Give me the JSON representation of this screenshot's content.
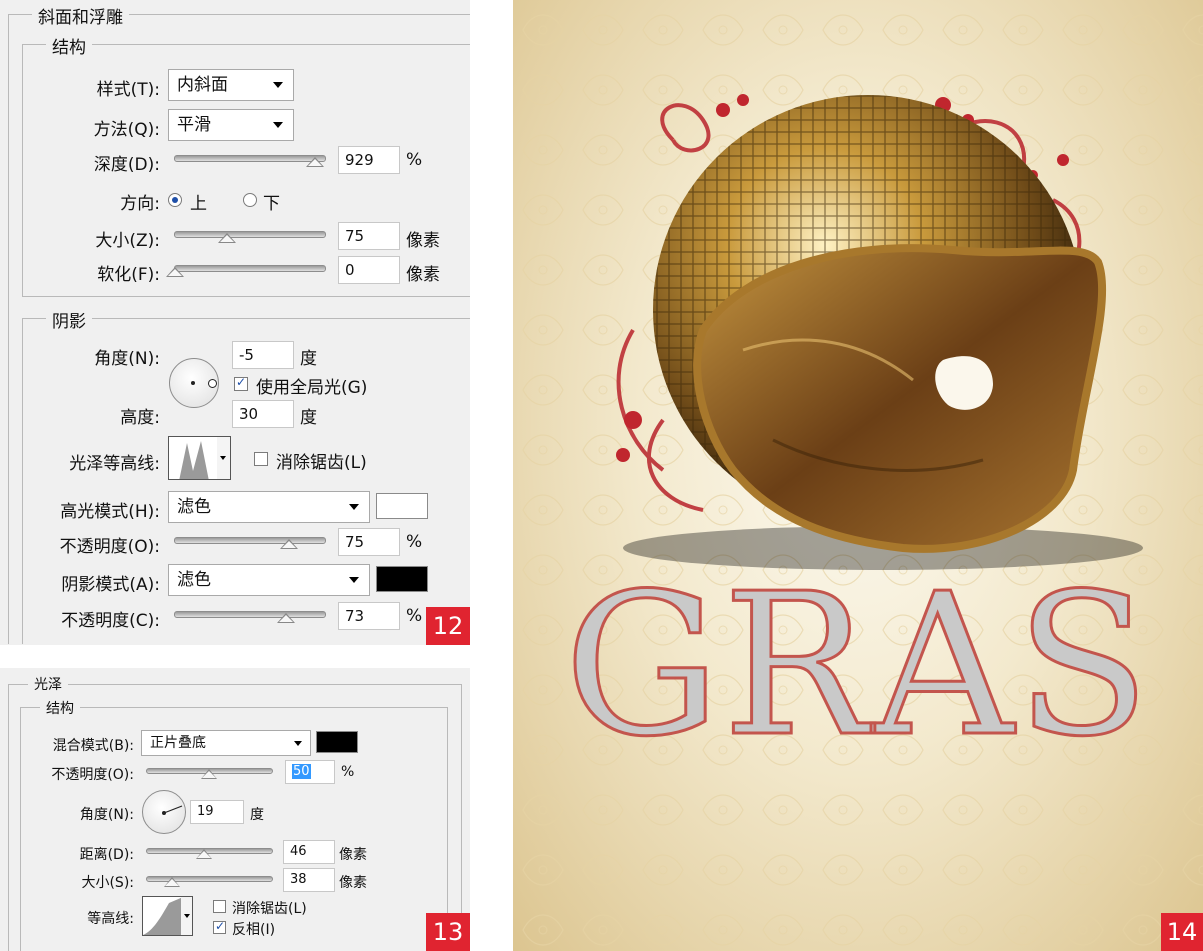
{
  "panel12": {
    "bevel_title": "斜面和浮雕",
    "structure_title": "结构",
    "style_label": "样式(T):",
    "style_value": "内斜面",
    "technique_label": "方法(Q):",
    "technique_value": "平滑",
    "depth_label": "深度(D):",
    "depth_value": "929",
    "depth_unit": "%",
    "direction_label": "方向:",
    "direction_up": "上",
    "direction_down": "下",
    "size_label": "大小(Z):",
    "size_value": "75",
    "size_unit": "像素",
    "soften_label": "软化(F):",
    "soften_value": "0",
    "soften_unit": "像素",
    "shading_title": "阴影",
    "angle_label": "角度(N):",
    "angle_value": "-5",
    "angle_unit": "度",
    "global_light_label": "使用全局光(G)",
    "altitude_label": "高度:",
    "altitude_value": "30",
    "altitude_unit": "度",
    "gloss_contour_label": "光泽等高线:",
    "antialias_label": "消除锯齿(L)",
    "highlight_mode_label": "高光模式(H):",
    "highlight_mode_value": "滤色",
    "highlight_color": "#ffffff",
    "highlight_opacity_label": "不透明度(O):",
    "highlight_opacity_value": "75",
    "highlight_opacity_unit": "%",
    "shadow_mode_label": "阴影模式(A):",
    "shadow_mode_value": "滤色",
    "shadow_color": "#000000",
    "shadow_opacity_label": "不透明度(C):",
    "shadow_opacity_value": "73",
    "shadow_opacity_unit": "%",
    "badge": "12"
  },
  "panel13": {
    "satin_title": "光泽",
    "structure_title": "结构",
    "blend_mode_label": "混合模式(B):",
    "blend_mode_value": "正片叠底",
    "blend_color": "#000000",
    "opacity_label": "不透明度(O):",
    "opacity_value": "50",
    "opacity_unit": "%",
    "angle_label": "角度(N):",
    "angle_value": "19",
    "angle_unit": "度",
    "distance_label": "距离(D):",
    "distance_value": "46",
    "distance_unit": "像素",
    "size_label": "大小(S):",
    "size_value": "38",
    "size_unit": "像素",
    "contour_label": "等高线:",
    "antialias_label": "消除锯齿(L)",
    "invert_label": "反相(I)",
    "badge": "13"
  },
  "poster": {
    "title": "GRAS",
    "badge": "14",
    "accent": "#c0392b"
  }
}
